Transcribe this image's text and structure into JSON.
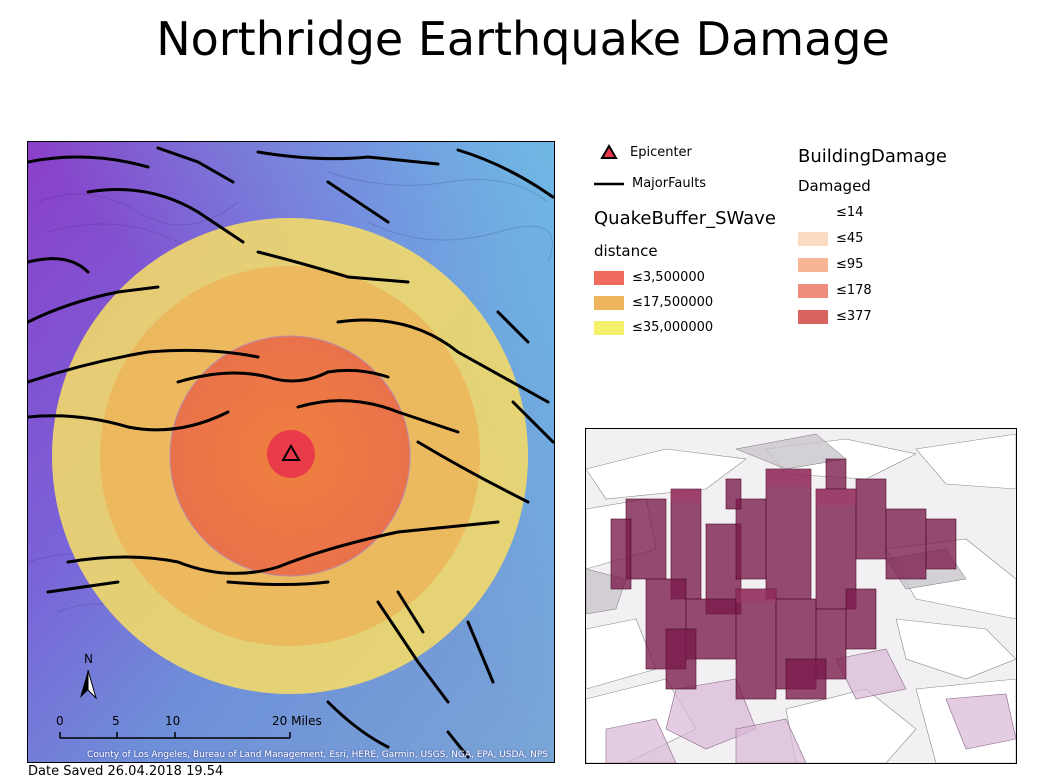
{
  "title": "Northridge Earthquake Damage",
  "date_saved": "Date Saved 26.04.2018 19.54",
  "map": {
    "credits": "County of Los Angeles, Bureau of Land Management, Esri, HERE, Garmin, USGS, NGA, EPA, USDA, NPS",
    "north_label": "N",
    "scale_labels": [
      "0",
      "5",
      "10",
      "20 Miles"
    ]
  },
  "legend": {
    "epicenter_label": "Epicenter",
    "faults_label": "MajorFaults",
    "buffer_title": "QuakeBuffer_SWave",
    "buffer_field": "distance",
    "buffer_classes": [
      {
        "label": "≤3,500000",
        "color": "#ef6b5b"
      },
      {
        "label": "≤17,500000",
        "color": "#eeb55f"
      },
      {
        "label": "≤35,000000",
        "color": "#f3f06c"
      }
    ],
    "damage_title": "BuildingDamage",
    "damage_field": "Damaged",
    "damage_classes": [
      {
        "label": "≤14",
        "color": "#ffffff"
      },
      {
        "label": "≤45",
        "color": "#fbdcc2"
      },
      {
        "label": "≤95",
        "color": "#f6b696"
      },
      {
        "label": "≤178",
        "color": "#ee8d7d"
      },
      {
        "label": "≤377",
        "color": "#d9635e"
      }
    ]
  }
}
